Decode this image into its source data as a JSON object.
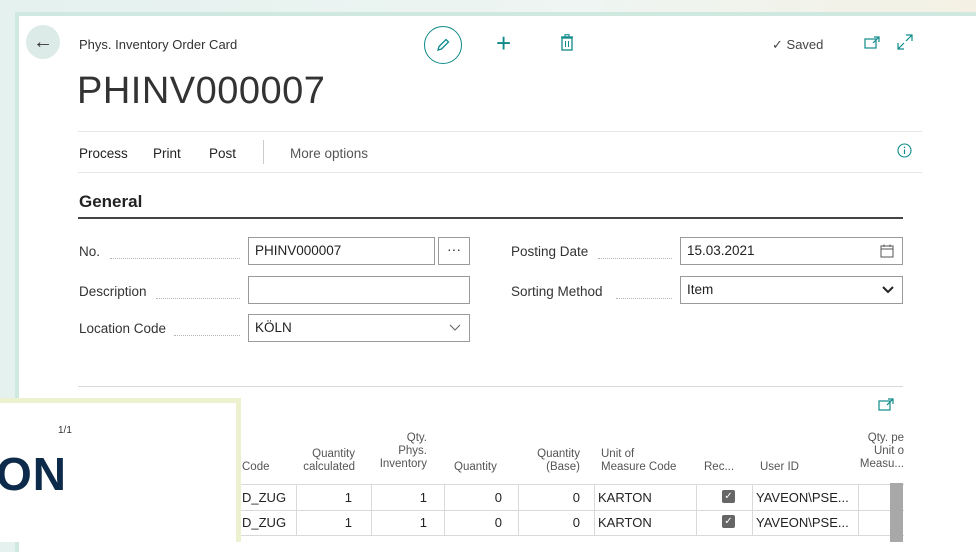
{
  "breadcrumb": "Phys. Inventory Order Card",
  "title": "PHINV000007",
  "status": "Saved",
  "actions": {
    "process": "Process",
    "print": "Print",
    "post": "Post",
    "more": "More options"
  },
  "section": "General",
  "fields": {
    "no": {
      "label": "No.",
      "value": "PHINV000007",
      "assist": "···"
    },
    "description": {
      "label": "Description",
      "value": ""
    },
    "location": {
      "label": "Location Code",
      "value": "KÖLN"
    },
    "posting_date": {
      "label": "Posting Date",
      "value": "15.03.2021"
    },
    "sorting": {
      "label": "Sorting Method",
      "value": "Item"
    }
  },
  "table": {
    "headers": {
      "code": "Code",
      "qty_calc": [
        "Quantity",
        "calculated"
      ],
      "qty_phys": [
        "Qty.",
        "Phys.",
        "Inventory"
      ],
      "qty": "Quantity",
      "qty_base": [
        "Quantity",
        "(Base)"
      ],
      "uom": [
        "Unit of",
        "Measure Code"
      ],
      "rec": "Rec...",
      "user": "User ID",
      "qty_per": [
        "Qty. pe",
        "Unit o",
        "Measu..."
      ]
    },
    "rows": [
      {
        "code": "D_ZUG",
        "qty_calc": "1",
        "qty_phys": "1",
        "qty": "0",
        "qty_base": "0",
        "uom": "KARTON",
        "user": "YAVEON\\PSE..."
      },
      {
        "code": "D_ZUG",
        "qty_calc": "1",
        "qty_phys": "1",
        "qty": "0",
        "qty_base": "0",
        "uom": "KARTON",
        "user": "YAVEON\\PSE..."
      }
    ]
  },
  "overlay": {
    "page": "1/1",
    "logo": "ON"
  }
}
